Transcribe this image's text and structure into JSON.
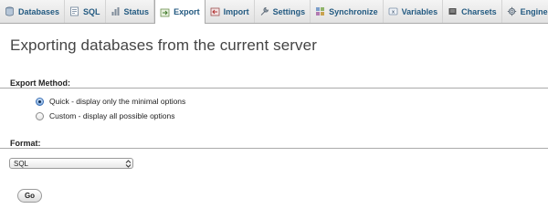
{
  "tabs": [
    {
      "label": "Databases",
      "icon": "database-icon"
    },
    {
      "label": "SQL",
      "icon": "sql-query-icon"
    },
    {
      "label": "Status",
      "icon": "status-icon"
    },
    {
      "label": "Export",
      "icon": "export-icon",
      "active": true
    },
    {
      "label": "Import",
      "icon": "import-icon"
    },
    {
      "label": "Settings",
      "icon": "wrench-icon"
    },
    {
      "label": "Synchronize",
      "icon": "synchronize-icon"
    },
    {
      "label": "Variables",
      "icon": "variables-icon"
    },
    {
      "label": "Charsets",
      "icon": "charsets-icon"
    },
    {
      "label": "Engines",
      "icon": "engines-icon"
    }
  ],
  "page": {
    "title": "Exporting databases from the current server"
  },
  "export_method": {
    "legend": "Export Method:",
    "options": [
      {
        "label": "Quick - display only the minimal options",
        "checked": true
      },
      {
        "label": "Custom - display all possible options",
        "checked": false
      }
    ]
  },
  "format": {
    "legend": "Format:",
    "selected": "SQL"
  },
  "go_button": {
    "label": "Go"
  },
  "colors": {
    "tab_text": "#235a81",
    "radio_checked": "#3a6fb5",
    "rule": "#aaaaaa"
  }
}
